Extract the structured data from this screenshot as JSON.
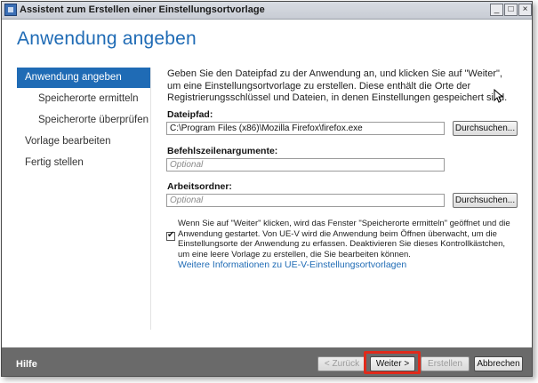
{
  "window": {
    "title": "Assistent zum Erstellen einer Einstellungsortvorlage",
    "min_glyph": "_",
    "max_glyph": "□",
    "close_glyph": "×"
  },
  "page": {
    "title": "Anwendung angeben",
    "intro": "Geben Sie den Dateipfad zu der Anwendung an, und klicken Sie auf \"Weiter\", um eine Einstellungsortvorlage zu erstellen. Diese enthält die Orte der Registrierungsschlüssel und Dateien, in denen Einstellungen gespeichert sind."
  },
  "nav": {
    "items": [
      {
        "label": "Anwendung angeben",
        "active": true,
        "sub": false
      },
      {
        "label": "Speicherorte ermitteln",
        "active": false,
        "sub": true
      },
      {
        "label": "Speicherorte überprüfen",
        "active": false,
        "sub": true
      },
      {
        "label": "Vorlage bearbeiten",
        "active": false,
        "sub": false
      },
      {
        "label": "Fertig stellen",
        "active": false,
        "sub": false
      }
    ]
  },
  "form": {
    "path_label": "Dateipfad:",
    "path_value": "C:\\Program Files (x86)\\Mozilla Firefox\\firefox.exe",
    "args_label": "Befehlszeilenargumente:",
    "args_placeholder": "Optional",
    "workdir_label": "Arbeitsordner:",
    "workdir_placeholder": "Optional",
    "browse_label": "Durchsuchen...",
    "checkbox_checked": true,
    "checkbox_text": "Wenn Sie auf \"Weiter\" klicken, wird das Fenster \"Speicherorte ermitteln\" geöffnet und die Anwendung gestartet. Von UE-V wird die Anwendung beim Öffnen überwacht, um die Einstellungsorte der Anwendung zu erfassen. Deaktivieren Sie dieses Kontrollkästchen, um eine leere Vorlage zu erstellen, die Sie bearbeiten können.",
    "info_link": "Weitere Informationen zu UE-V-Einstellungsortvorlagen"
  },
  "footer": {
    "help_label": "Hilfe",
    "back_label": "< Zurück",
    "next_label": "Weiter >",
    "finish_label": "Erstellen",
    "cancel_label": "Abbrechen"
  },
  "colors": {
    "accent": "#1f6bb5",
    "footer_bg": "#6a6a6a",
    "highlight": "#e02a1b"
  }
}
